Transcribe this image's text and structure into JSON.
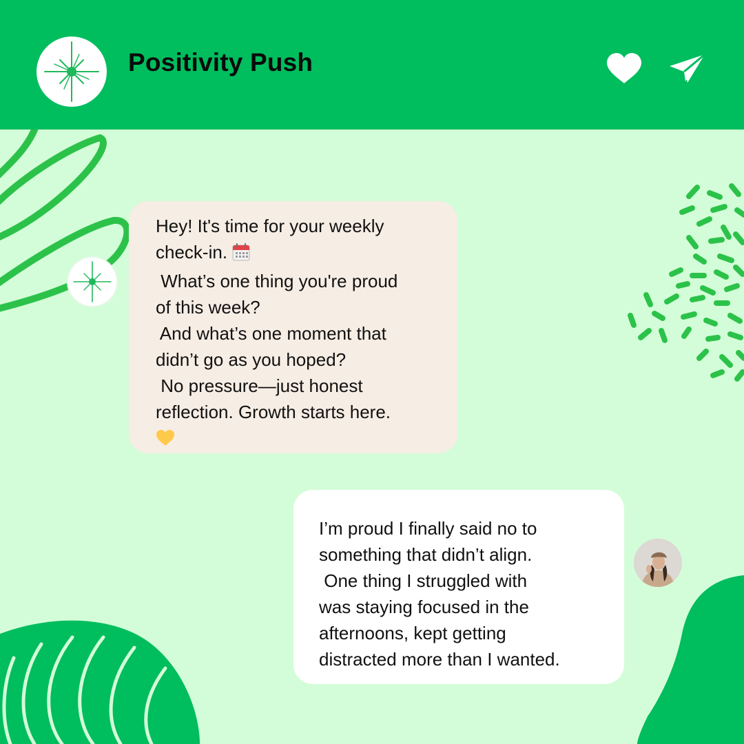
{
  "header": {
    "title": "Positivity Push",
    "logo_icon": "sparkle-star-icon",
    "actions": [
      {
        "icon": "heart-icon"
      },
      {
        "icon": "paper-plane-icon"
      }
    ]
  },
  "messages": [
    {
      "sender": "bot",
      "avatar_icon": "sparkle-star-icon",
      "lines": [
        "Hey! It's time for your weekly",
        "check-in.",
        " What’s one thing you're proud",
        "of this week?",
        " And what’s one moment that",
        "didn’t go as you hoped?",
        " No pressure—just honest",
        "reflection. Growth starts here."
      ],
      "emojis": [
        "calendar-icon",
        "yellow-heart-icon"
      ]
    },
    {
      "sender": "user",
      "avatar_icon": "user-photo-avatar",
      "lines": [
        "I’m proud I finally said no to",
        "something that didn’t align.",
        " One thing I struggled with",
        "was staying focused in the",
        "afternoons, kept getting",
        "distracted more than I wanted."
      ]
    }
  ],
  "colors": {
    "header_green": "#00bd5e",
    "background_mint": "#d3fdd8",
    "bot_bubble": "#f6ede4",
    "user_bubble": "#ffffff",
    "accent_green": "#22c24a",
    "heart_yellow": "#ffc94a"
  }
}
